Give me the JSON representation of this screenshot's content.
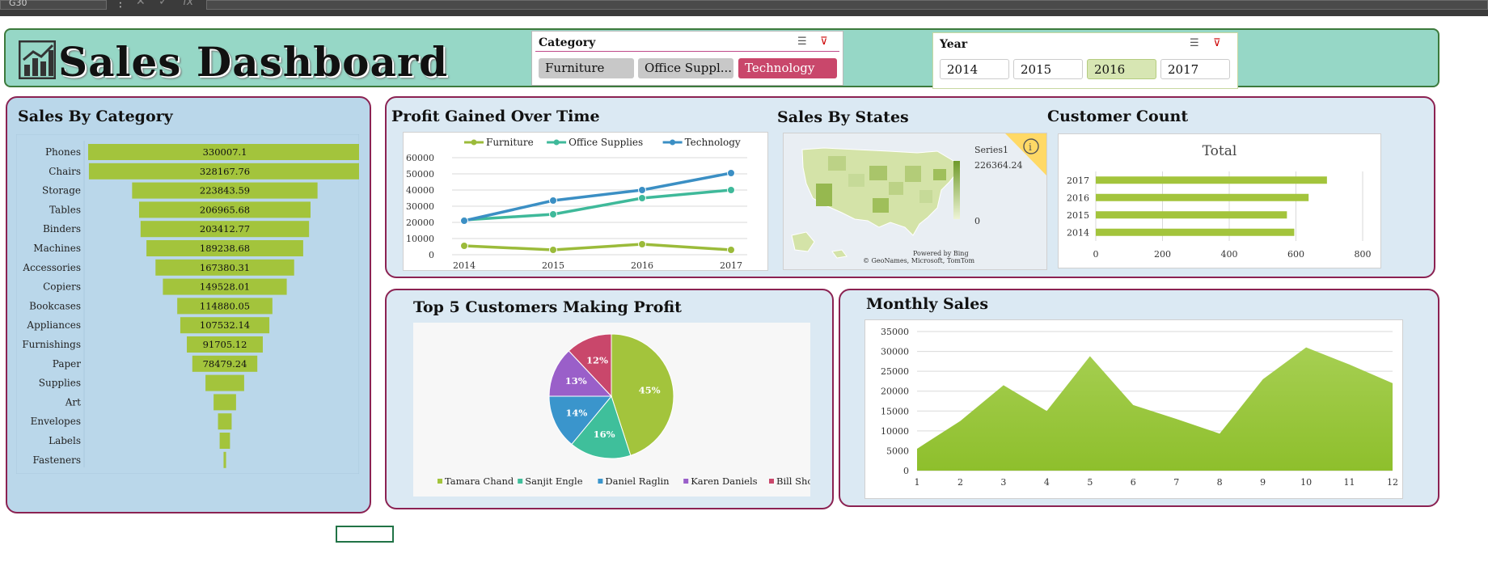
{
  "formula_bar": {
    "name_box": "G30",
    "fx": "fx"
  },
  "header": {
    "title": "Sales Dashboard"
  },
  "slicers": {
    "category": {
      "title": "Category",
      "items": [
        {
          "label": "Furniture",
          "state": "unselected"
        },
        {
          "label": "Office Suppl...",
          "state": "unselected"
        },
        {
          "label": "Technology",
          "state": "selected"
        }
      ]
    },
    "year": {
      "title": "Year",
      "items": [
        {
          "label": "2014",
          "state": "unselected"
        },
        {
          "label": "2015",
          "state": "unselected"
        },
        {
          "label": "2016",
          "state": "selected"
        },
        {
          "label": "2017",
          "state": "unselected"
        }
      ]
    }
  },
  "sales_by_category": {
    "title": "Sales By Category",
    "chart_data": {
      "type": "bar",
      "orientation": "funnel",
      "categories": [
        "Phones",
        "Chairs",
        "Storage",
        "Tables",
        "Binders",
        "Machines",
        "Accessories",
        "Copiers",
        "Bookcases",
        "Appliances",
        "Furnishings",
        "Paper",
        "Supplies",
        "Art",
        "Envelopes",
        "Labels",
        "Fasteners"
      ],
      "values": [
        330007.1,
        328167.76,
        223843.59,
        206965.68,
        203412.77,
        189238.68,
        167380.31,
        149528.01,
        114880.05,
        107532.14,
        91705.12,
        78479.24,
        46673.54,
        27118.79,
        16476.4,
        12486.31,
        3024.28
      ],
      "labels": [
        "330007.1",
        "328167.76",
        "223843.59",
        "206965.68",
        "203412.77",
        "189238.68",
        "167380.31",
        "149528.01",
        "114880.05",
        "107532.14",
        "91705.12",
        "78479.24",
        "",
        "",
        "",
        "",
        ""
      ],
      "color": "#a3c43c"
    }
  },
  "profit_over_time": {
    "title": "Profit  Gained Over Time",
    "chart_data": {
      "type": "line",
      "x": [
        "2014",
        "2015",
        "2016",
        "2017"
      ],
      "ylim": [
        0,
        60000
      ],
      "yticks": [
        "60000",
        "50000",
        "40000",
        "30000",
        "20000",
        "10000",
        "0"
      ],
      "series": [
        {
          "name": "Furniture",
          "values": [
            5500,
            3000,
            6500,
            3000
          ],
          "color": "#9bbb3a"
        },
        {
          "name": "Office Supplies",
          "values": [
            21500,
            25000,
            35000,
            40000
          ],
          "color": "#3fb99a"
        },
        {
          "name": "Technology",
          "values": [
            21000,
            33500,
            40000,
            50500
          ],
          "color": "#3b8fc4"
        }
      ]
    }
  },
  "sales_by_states": {
    "title": "Sales By States",
    "legend_title": "Series1",
    "legend_max": "226364.24",
    "legend_min": "0",
    "attribution_1": "Powered by Bing",
    "attribution_2": "© GeoNames, Microsoft, TomTom"
  },
  "customer_count": {
    "title": "Customer Count",
    "chart_data": {
      "type": "bar",
      "orientation": "horizontal",
      "title": "Total",
      "categories": [
        "2017",
        "2016",
        "2015",
        "2014"
      ],
      "values": [
        693,
        638,
        573,
        595
      ],
      "xlim": [
        0,
        800
      ],
      "xticks": [
        "0",
        "200",
        "400",
        "600",
        "800"
      ],
      "color": "#a3c43c"
    }
  },
  "top_customers": {
    "title": "Top 5 Customers Making Profit",
    "chart_data": {
      "type": "pie",
      "labels": [
        "Tamara Chand",
        "Sanjit Engle",
        "Daniel Raglin",
        "Karen Daniels",
        "Bill Shonely"
      ],
      "values": [
        45,
        16,
        14,
        13,
        12
      ],
      "value_labels": [
        "45%",
        "16%",
        "14%",
        "13%",
        "12%"
      ],
      "colors": [
        "#a3c43c",
        "#3fbf9b",
        "#3a95cc",
        "#9a5fc9",
        "#c9476b"
      ]
    }
  },
  "monthly_sales": {
    "title": "Monthly Sales",
    "chart_data": {
      "type": "area",
      "x": [
        "1",
        "2",
        "3",
        "4",
        "5",
        "6",
        "7",
        "8",
        "9",
        "10",
        "11",
        "12"
      ],
      "values": [
        5500,
        12500,
        21500,
        15000,
        28800,
        16500,
        13000,
        9300,
        23000,
        31000,
        26700,
        22000
      ],
      "ylim": [
        0,
        35000
      ],
      "yticks": [
        "35000",
        "30000",
        "25000",
        "20000",
        "15000",
        "10000",
        "5000",
        "0"
      ],
      "color": "#8ebf2c"
    }
  }
}
